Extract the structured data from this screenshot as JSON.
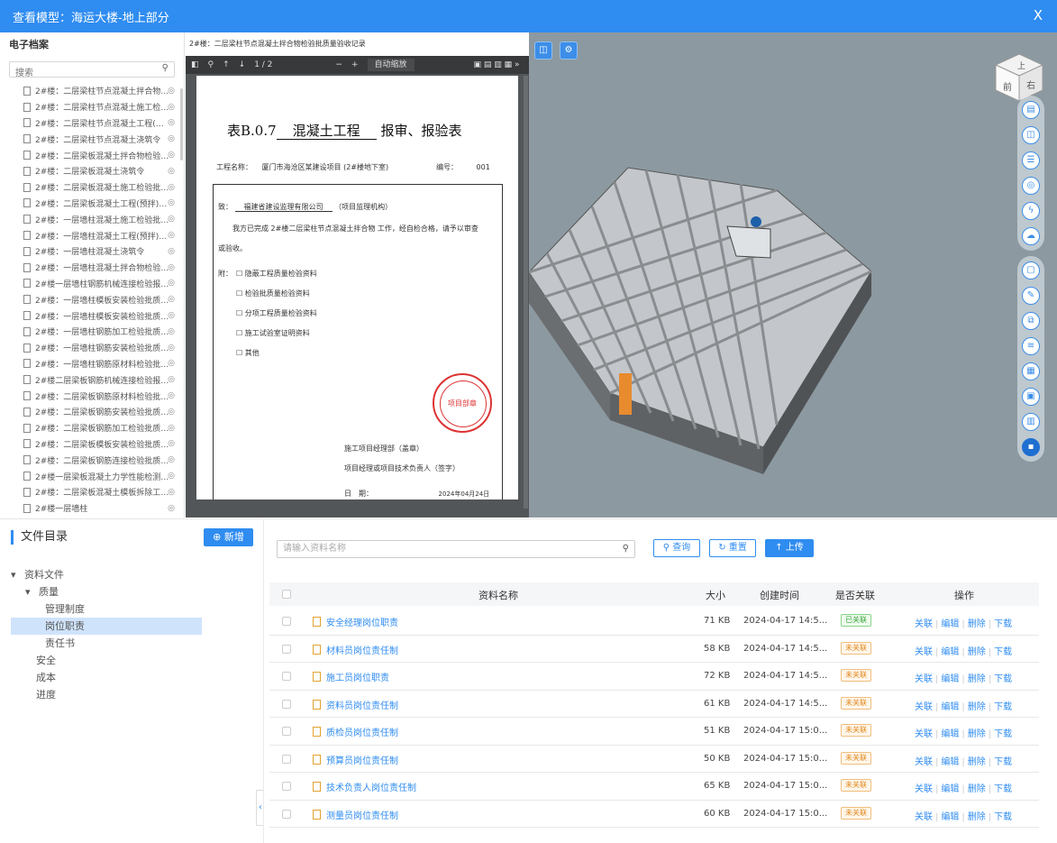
{
  "window": {
    "title": "查看模型：海运大楼-地上部分",
    "close": "X"
  },
  "archive": {
    "title": "电子档案",
    "search_placeholder": "搜索",
    "items": [
      "2#楼：二层梁柱节点混凝土拌合物检验批...",
      "2#楼：二层梁柱节点混凝土施工检验批质...",
      "2#楼：二层梁柱节点混凝土工程(预拌)施...",
      "2#楼：二层梁柱节点混凝土浇筑令",
      "2#楼：二层梁板混凝土拌合物检验批质量...",
      "2#楼：二层梁板混凝土浇筑令",
      "2#楼：二层梁板混凝土施工检验批质量验...",
      "2#楼：二层梁板混凝土工程(预拌)施工记录",
      "2#楼：一层墙柱混凝土施工检验批质量验...",
      "2#楼：一层墙柱混凝土工程(预拌)施工记录",
      "2#楼：一层墙柱混凝土浇筑令",
      "2#楼：一层墙柱混凝土拌合物检验批质量...",
      "2#楼一层墙柱钢筋机械连接检验报告SFC...",
      "2#楼：一层墙柱模板安装检验批质量验收...",
      "2#楼：一层墙柱模板安装检验批质量验收...",
      "2#楼：一层墙柱钢筋加工检验批质量验收...",
      "2#楼：一层墙柱钢筋安装检验批质量验收...",
      "2#楼：一层墙柱钢筋原材料检验批质量验...",
      "2#楼二层梁板钢筋机械连接检验报告SFC...",
      "2#楼：二层梁板钢筋原材料检验批质量验...",
      "2#楼：二层梁板钢筋安装检验批质量验收...",
      "2#楼：二层梁板钢筋加工检验批质量验收...",
      "2#楼：二层梁板模板安装检验批质量验收...",
      "2#楼：二层梁板钢筋连接检验批质量验收...",
      "2#楼一层梁板混凝土力学性能检测报告S...",
      "2#楼：二层梁板混凝土模板拆除工序申请...",
      "2#楼一层墙柱"
    ]
  },
  "pdf": {
    "header": "2#楼：二层梁柱节点混凝土拌合物检验批质量验收记录",
    "page_indicator": "1 / 2",
    "zoom": "自动缩放",
    "doc_title_prefix": "表B.0.7",
    "doc_title_underline": "混凝土工程",
    "doc_title_suffix": "报审、报验表",
    "project_label": "工程名称：",
    "project_name": "厦门市海沧区某建设项目 (2#楼地下室)",
    "number_label": "编号：",
    "number_value": "001",
    "to_label": "致：",
    "to_value": "福建省建设监理有限公司",
    "to_suffix": "（项目监理机构）",
    "body_line": "我方已完成  2#楼二层梁柱节点混凝土拌合物  工作，经自检合格，请予以审查",
    "body_line2": "或验收。",
    "attach_label": "附：",
    "attachments": [
      "隐蔽工程质量检验资料",
      "检验批质量检验资料",
      "分项工程质量检验资料",
      "施工试验室证明资料",
      "其他"
    ],
    "sign1": "施工项目经理部（盖章）",
    "sign2": "项目经理或项目技术负责人（签字）",
    "date_label": "日　期：",
    "date_value": "2024年04月24日",
    "stamp_text": "项目部章"
  },
  "viewport": {
    "cube_top": "上",
    "cube_front": "前",
    "cube_right": "右"
  },
  "dir": {
    "title": "文件目录",
    "new_button": "新增",
    "tree": {
      "root": "资料文件",
      "quality": "质量",
      "quality_children": [
        "管理制度",
        "岗位职责",
        "责任书"
      ],
      "others": [
        "安全",
        "成本",
        "进度"
      ]
    }
  },
  "files": {
    "search_placeholder": "请输入资料名称",
    "query_button": "查询",
    "reset_button": "重置",
    "upload_button": "上传",
    "headers": {
      "name": "资料名称",
      "size": "大小",
      "created": "创建时间",
      "linked": "是否关联",
      "ops": "操作"
    },
    "op_labels": {
      "link": "关联",
      "edit": "编辑",
      "delete": "删除",
      "download": "下载"
    },
    "rows": [
      {
        "name": "安全经理岗位职责",
        "size": "71 KB",
        "time": "2024-04-17 14:5...",
        "status": "已关联",
        "linked": true
      },
      {
        "name": "材料员岗位责任制",
        "size": "58 KB",
        "time": "2024-04-17 14:5...",
        "status": "未关联",
        "linked": false
      },
      {
        "name": "施工员岗位职责",
        "size": "72 KB",
        "time": "2024-04-17 14:5...",
        "status": "未关联",
        "linked": false
      },
      {
        "name": "资料员岗位责任制",
        "size": "61 KB",
        "time": "2024-04-17 14:5...",
        "status": "未关联",
        "linked": false
      },
      {
        "name": "质检员岗位责任制",
        "size": "51 KB",
        "time": "2024-04-17 15:0...",
        "status": "未关联",
        "linked": false
      },
      {
        "name": "预算员岗位责任制",
        "size": "50 KB",
        "time": "2024-04-17 15:0...",
        "status": "未关联",
        "linked": false
      },
      {
        "name": "技术负责人岗位责任制",
        "size": "65 KB",
        "time": "2024-04-17 15:0...",
        "status": "未关联",
        "linked": false
      },
      {
        "name": "测量员岗位责任制",
        "size": "60 KB",
        "time": "2024-04-17 15:0...",
        "status": "未关联",
        "linked": false
      }
    ]
  },
  "colors": {
    "accent": "#2f8cf0",
    "linked": "#3aa33a",
    "unlinked": "#e0871a",
    "viewport_bg": "#8c99a0"
  }
}
